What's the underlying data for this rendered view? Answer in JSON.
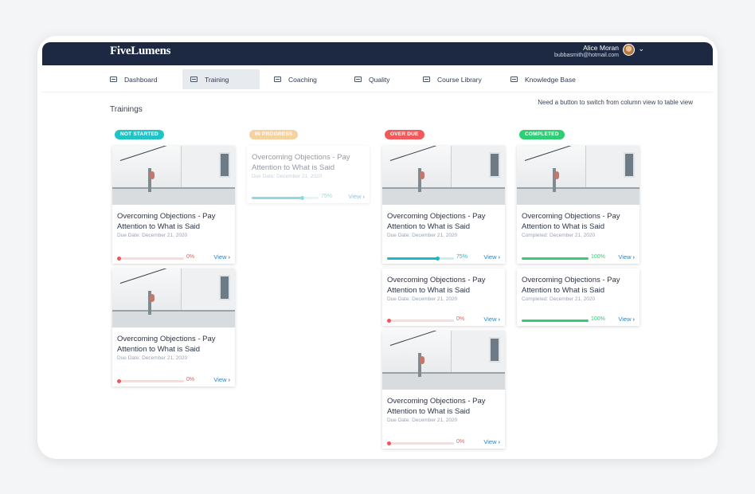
{
  "app": {
    "logo": "FiveLumens"
  },
  "user": {
    "name": "Alice Moran",
    "email": "bubbasmith@hotmail.com"
  },
  "nav": [
    {
      "label": "Dashboard",
      "active": false
    },
    {
      "label": "Training",
      "active": true
    },
    {
      "label": "Coaching",
      "active": false
    },
    {
      "label": "Quality",
      "active": false
    },
    {
      "label": "Course Library",
      "active": false
    },
    {
      "label": "Knowledge Base",
      "active": false
    }
  ],
  "page": {
    "title": "Trainings",
    "hint": "Need a button to switch from column view to table view"
  },
  "colors": {
    "not_started": "#22c3c6",
    "in_progress": "#f3b564",
    "over_due": "#ef5b5b",
    "completed": "#2fce75",
    "progress_teal": "#1fb6c9",
    "progress_red": "#f0575a",
    "progress_green": "#2fce75",
    "link": "#2a84c7"
  },
  "columns": [
    {
      "status": "NOT STARTED",
      "cards": [
        {
          "title": "Overcoming Objections - Pay Attention to What is Said",
          "date": "Due Date: December 21, 2020",
          "progress": "0%",
          "view": "View"
        },
        {
          "title": "Overcoming Objections - Pay Attention to What is Said",
          "date": "Due Date: December 21, 2020",
          "progress": "0%",
          "view": "View"
        }
      ]
    },
    {
      "status": "IN PROGRESS",
      "cards": [
        {
          "title": "Overcoming Objections - Pay Attention to What is Said",
          "date": "Due Date: December 21, 2020",
          "progress": "75%",
          "view": "View"
        }
      ]
    },
    {
      "status": "OVER DUE",
      "cards": [
        {
          "title": "Overcoming Objections - Pay Attention to What is Said",
          "date": "Due Date: December 21, 2020",
          "progress": "75%",
          "view": "View"
        },
        {
          "title": "Overcoming Objections - Pay Attention to What is Said",
          "date": "Due Date: December 21, 2020",
          "progress": "0%",
          "view": "View"
        },
        {
          "title": "Overcoming Objections - Pay Attention to What is Said",
          "date": "Due Date: December 21, 2020",
          "progress": "0%",
          "view": "View"
        }
      ]
    },
    {
      "status": "COMPLETED",
      "cards": [
        {
          "title": "Overcoming Objections - Pay Attention to What is Said",
          "date": "Completed: December 21, 2020",
          "progress": "100%",
          "view": "View"
        },
        {
          "title": "Overcoming Objections - Pay Attention to What is Said",
          "date": "Completed: December 21, 2020",
          "progress": "100%",
          "view": "View"
        }
      ]
    }
  ]
}
